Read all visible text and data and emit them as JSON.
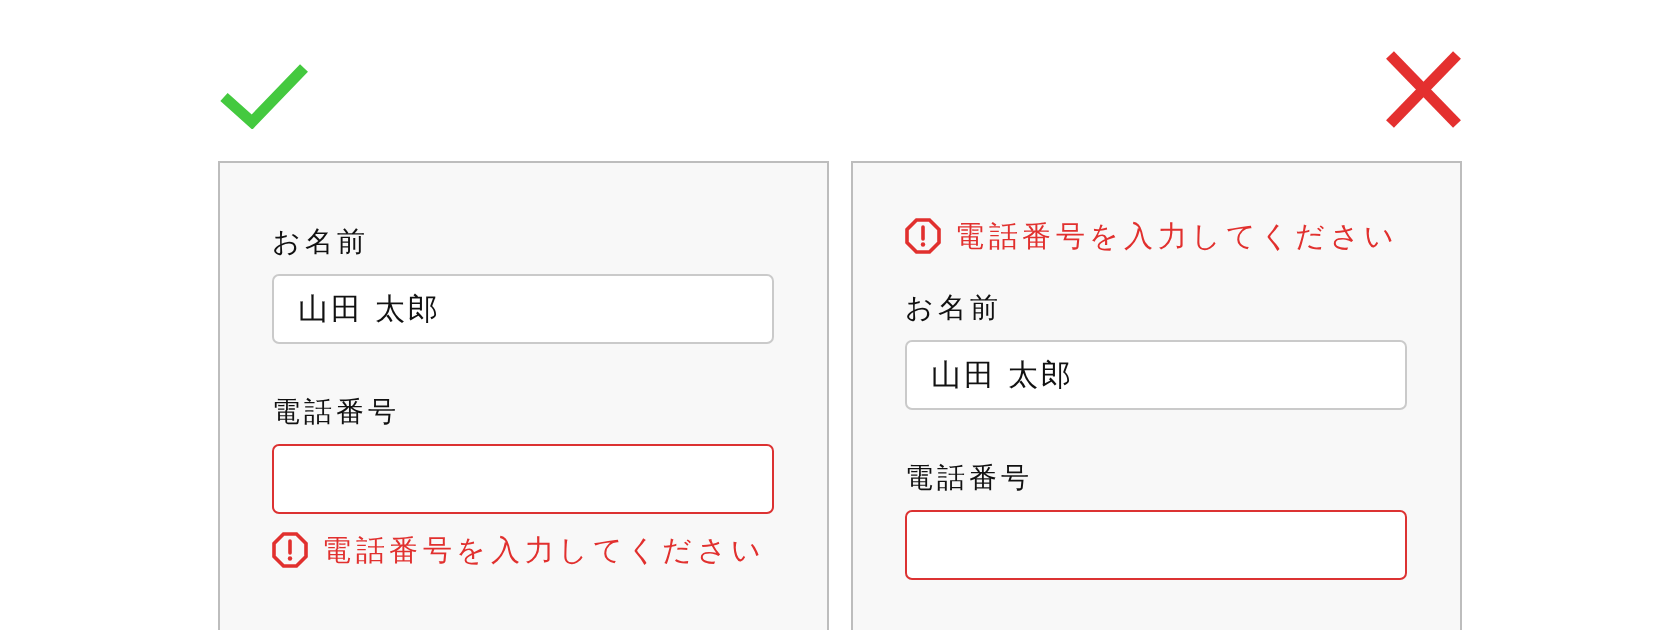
{
  "examples": [
    {
      "kind": "good",
      "items": [
        {
          "kind": "field",
          "label": "お名前",
          "value": "山田 太郎",
          "invalid": false
        },
        {
          "kind": "field",
          "label": "電話番号",
          "invalid": true
        },
        {
          "kind": "error",
          "message": "電話番号を入力してください"
        }
      ]
    },
    {
      "kind": "bad",
      "items": [
        {
          "kind": "error",
          "message": "電話番号を入力してください"
        },
        {
          "kind": "field",
          "label": "お名前",
          "value": "山田 太郎",
          "invalid": false
        },
        {
          "kind": "field",
          "label": "電話番号",
          "invalid": true
        }
      ]
    }
  ]
}
